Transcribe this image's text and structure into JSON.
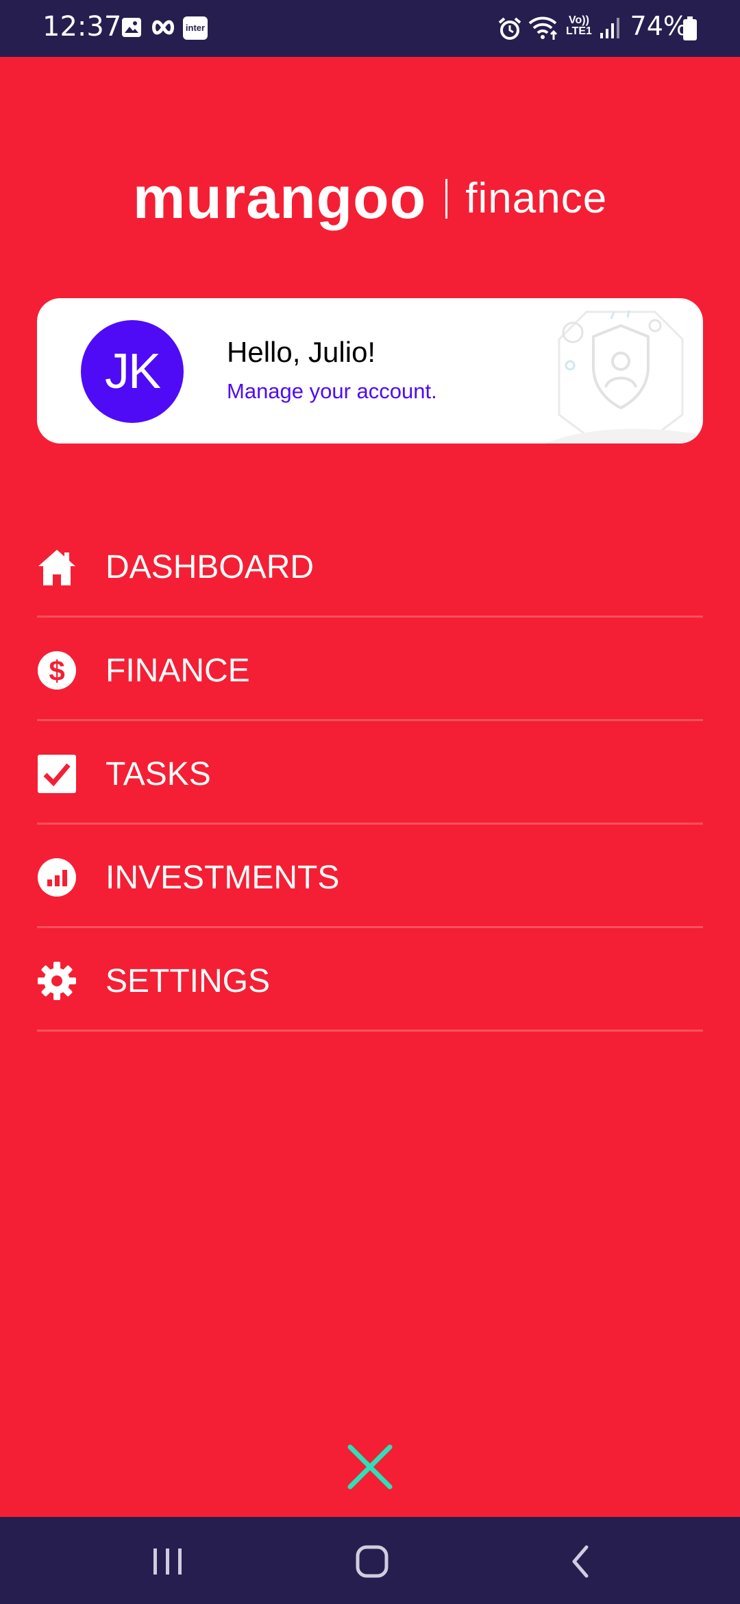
{
  "status_bar": {
    "time": "12:37",
    "battery": "74%",
    "inter_badge": "inter",
    "network_top": "Vo))",
    "network_bottom": "LTE1",
    "icons": [
      "gallery-icon",
      "infinity-icon",
      "inter-app-icon",
      "alarm-icon",
      "wifi-icon",
      "signal-icon",
      "battery-icon"
    ]
  },
  "logo": {
    "brand": "murangoo",
    "product": "finance"
  },
  "account_card": {
    "initials": "JK",
    "greeting": "Hello, Julio!",
    "link_text": "Manage your account."
  },
  "menu": {
    "items": [
      {
        "label": "DASHBOARD",
        "icon": "home-icon"
      },
      {
        "label": "FINANCE",
        "icon": "dollar-circle-icon"
      },
      {
        "label": "TASKS",
        "icon": "checkbox-icon"
      },
      {
        "label": "INVESTMENTS",
        "icon": "bar-chart-circle-icon"
      },
      {
        "label": "SETTINGS",
        "icon": "gear-icon"
      }
    ]
  },
  "colors": {
    "background": "#F41F34",
    "bars": "#261E4E",
    "accent_purple": "#4F0BF6",
    "close_teal": "#2EE0B7"
  },
  "navigation": {
    "buttons": [
      "recent-apps-icon",
      "home-button-icon",
      "back-icon"
    ]
  }
}
